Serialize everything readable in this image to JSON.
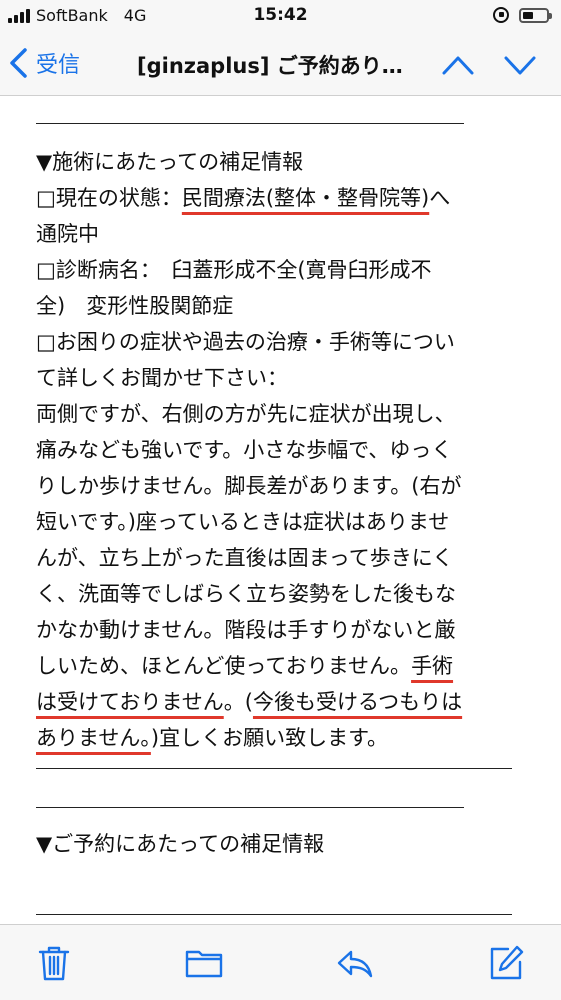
{
  "status_bar": {
    "carrier": "SoftBank",
    "network": "4G",
    "time": "15:42",
    "battery_level": 0.45
  },
  "nav": {
    "back_label": "受信",
    "title": "[ginzaplus] ご予約あり…",
    "accent_color": "#1a73e8"
  },
  "body": {
    "lines": [
      "▼施術にあたっての補足情報",
      "",
      "通院中",
      "",
      "全)　変形性股関節症",
      "□お困りの症状や過去の治療・手術等につい",
      "て詳しくお聞かせ下さい：",
      "両側ですが、右側の方が先に症状が出現し、",
      "痛みなども強いです。小さな歩幅で、ゆっく",
      "りしか歩けません。脚長差があります。(右が",
      "短いです。)座っているときは症状はありませ",
      "んが、立ち上がった直後は固まって歩きにく",
      "く、洗面等でしばらく立ち姿勢をした後もな",
      "かなか動けません。階段は手すりがないと厳",
      "",
      "",
      "",
      "▼ご予約にあたっての補足情報"
    ],
    "status_label": "□現在の状態：",
    "status_value": "民間療法(整体・整骨院等)",
    "status_tail": "へ",
    "diagnosis_label": "□診断病名：　",
    "diagnosis_value": "臼蓋形成不全(寛骨臼形成不",
    "line14_plain": "しいため、ほとんど使っておりません。",
    "line14_ul": "手術",
    "line15_ul1": "は受けておりません",
    "line15_mid": "。(",
    "line15_ul2": "今後も受けるつもりは",
    "line16_ul": "ありません。",
    "line16_tail": ")宜しくお願い致します。",
    "underline_color": "#e0382b"
  },
  "toolbar": {
    "icons": [
      "trash-icon",
      "folder-icon",
      "reply-icon",
      "compose-icon"
    ]
  }
}
